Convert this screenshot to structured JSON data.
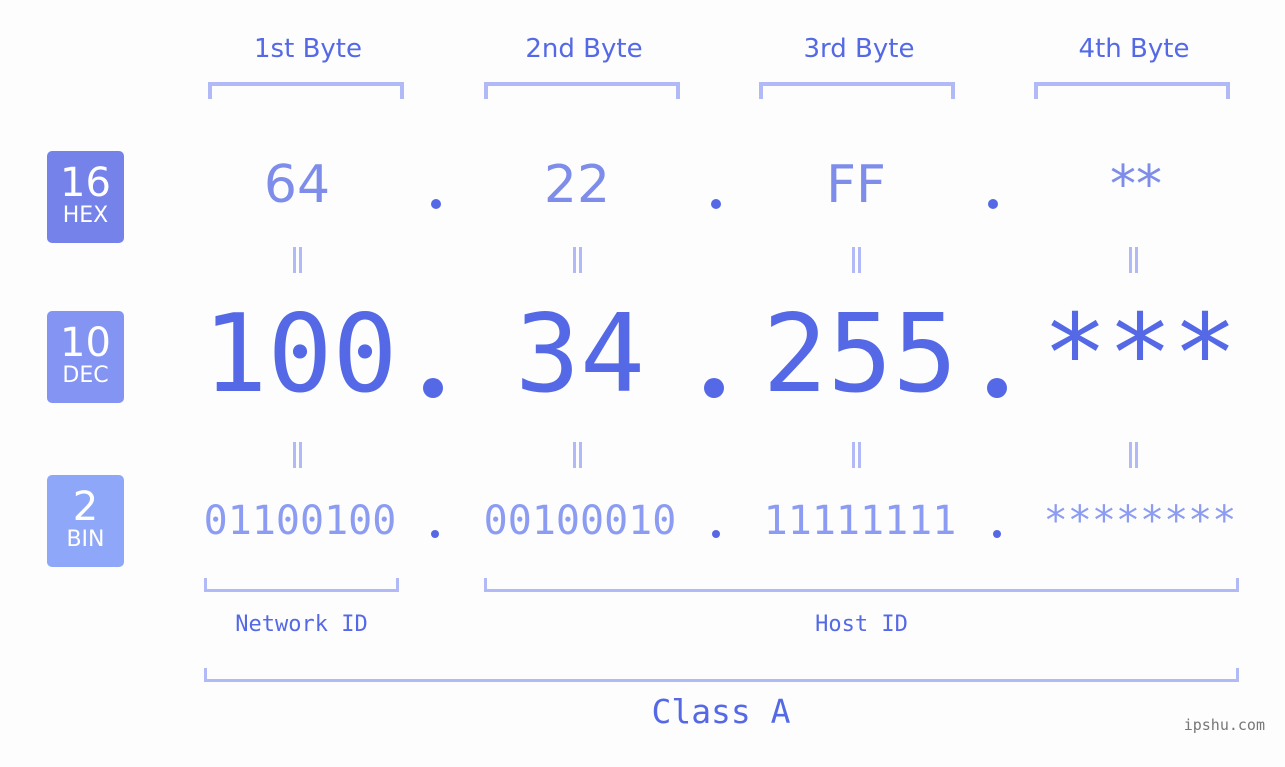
{
  "byte_headers": [
    "1st Byte",
    "2nd Byte",
    "3rd Byte",
    "4th Byte"
  ],
  "badges": [
    {
      "base": "16",
      "label": "HEX",
      "color": "#7482ea"
    },
    {
      "base": "10",
      "label": "DEC",
      "color": "#8494f2"
    },
    {
      "base": "2",
      "label": "BIN",
      "color": "#8ea7f8"
    }
  ],
  "hex": [
    "64",
    "22",
    "FF",
    "**"
  ],
  "dec": [
    "100",
    "34",
    "255",
    "***"
  ],
  "bin": [
    "01100100",
    "00100010",
    "11111111",
    "********"
  ],
  "network_id_label": "Network ID",
  "host_id_label": "Host ID",
  "class_label": "Class A",
  "watermark": "ipshu.com"
}
